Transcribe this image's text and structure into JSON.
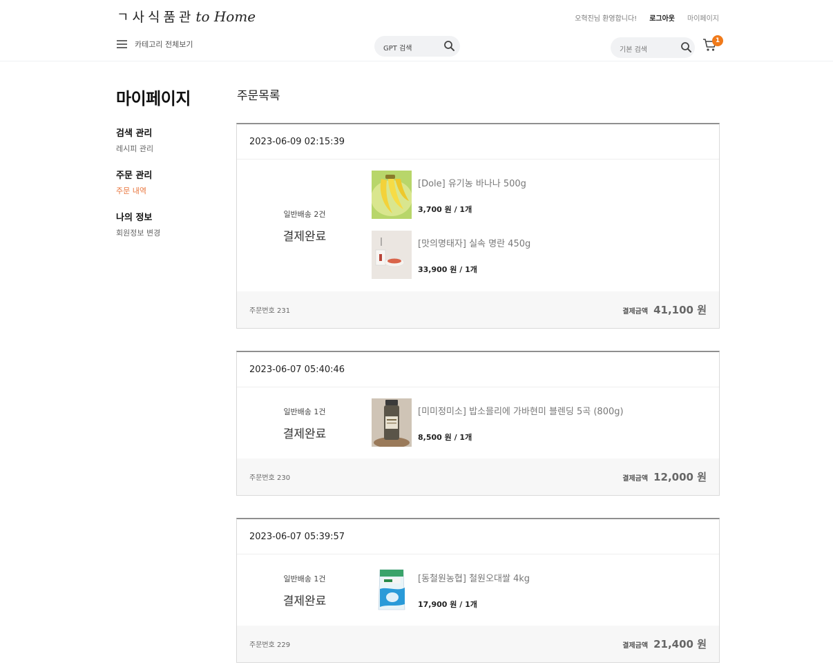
{
  "header": {
    "logo_kr": "ㄱ사식품관",
    "logo_script": "to Home",
    "greeting": "오혁진님 환영합니다!",
    "logout": "로그아웃",
    "mypage": "마이페이지",
    "category_label": "카테고리 전체보기",
    "gpt_search_placeholder": "GPT 검색",
    "basic_search_placeholder": "기본 검색",
    "cart_count": "1"
  },
  "sidebar": {
    "title": "마이페이지",
    "groups": [
      {
        "heading": "검색 관리",
        "link": "레시피 관리"
      },
      {
        "heading": "주문 관리",
        "link": "주문 내역"
      },
      {
        "heading": "나의 정보",
        "link": "회원정보 변경"
      }
    ]
  },
  "main": {
    "title": "주문목록",
    "total_label": "결제금액",
    "orders": [
      {
        "datetime": "2023-06-09 02:15:39",
        "shipping": "일반배송 2건",
        "status": "결제완료",
        "items": [
          {
            "name": "[Dole] 유기농 바나나 500g",
            "price": "3,700 원 / 1개",
            "image": "banana-image"
          },
          {
            "name": "[맛의명태자] 실속 명란 450g",
            "price": "33,900 원 / 1개",
            "image": "pollock-roe-image"
          }
        ],
        "order_no": "주문번호 231",
        "total": "41,100 원"
      },
      {
        "datetime": "2023-06-07 05:40:46",
        "shipping": "일반배송 1건",
        "status": "결제완료",
        "items": [
          {
            "name": "[미미정미소] 밥소믈리에 가바현미 블렌딩 5곡 (800g)",
            "price": "8,500 원 / 1개",
            "image": "grain-jar-image"
          }
        ],
        "order_no": "주문번호 230",
        "total": "12,000 원"
      },
      {
        "datetime": "2023-06-07 05:39:57",
        "shipping": "일반배송 1건",
        "status": "결제완료",
        "items": [
          {
            "name": "[동철원농협] 철원오대쌀 4kg",
            "price": "17,900 원 / 1개",
            "image": "rice-bag-image"
          }
        ],
        "order_no": "주문번호 229",
        "total": "21,400 원"
      }
    ]
  },
  "colors": {
    "accent_orange": "#e8743b",
    "badge": "#f07a1a",
    "footer_bg": "#f7f7f7"
  }
}
